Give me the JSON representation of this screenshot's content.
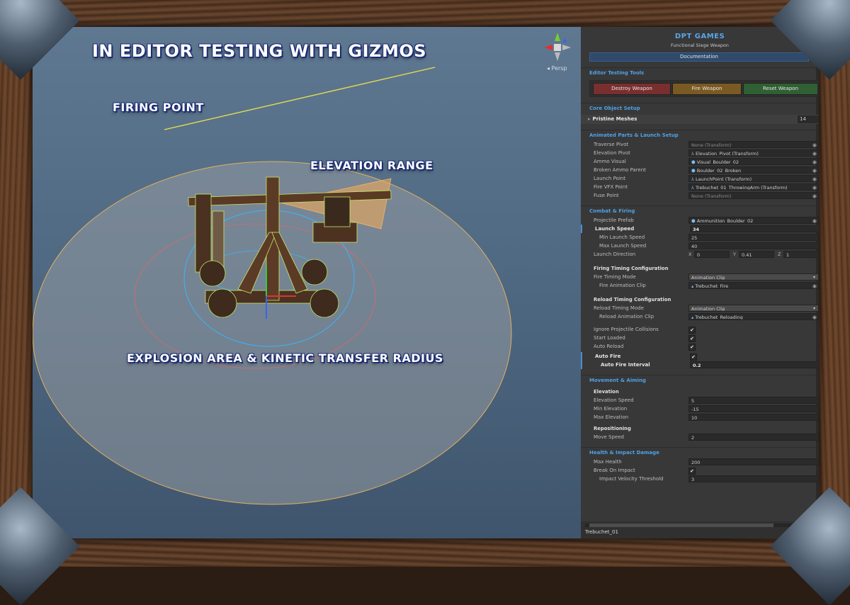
{
  "viewport": {
    "title": "IN EDITOR TESTING WITH GIZMOS",
    "labels": {
      "firing_point": "FIRING POINT",
      "elevation_range": "ELEVATION RANGE",
      "explosion": "EXPLOSION AREA & KINETIC TRANSFER RADIUS"
    },
    "persp_label": "◂ Persp",
    "colors": {
      "gizmo_line": "#e8e04a",
      "radius_outer": "#e0b060",
      "radius_inner": "#d86a6a",
      "wire": "#39b5ff"
    }
  },
  "inspector": {
    "title": "DPT GAMES",
    "subtitle": "Functional Siege Weapon",
    "documentation": "Documentation",
    "editor_tools": {
      "heading": "Editor Testing Tools",
      "buttons": [
        {
          "label": "Destroy Weapon",
          "color": "#7a2f2f"
        },
        {
          "label": "Fire Weapon",
          "color": "#7a5a22"
        },
        {
          "label": "Reset Weapon",
          "color": "#2f5f32"
        }
      ]
    },
    "core": {
      "heading": "Core Object Setup",
      "pristine_label": "Pristine Meshes",
      "pristine_count": "14"
    },
    "animated": {
      "heading": "Animated Parts & Launch Setup",
      "rows": [
        {
          "label": "Traverse Pivot",
          "value": "None (Transform)",
          "icon": "",
          "empty": true
        },
        {
          "label": "Elevation Pivot",
          "value": "Elevation_Pivot (Transform)",
          "icon": "⅄",
          "empty": false
        },
        {
          "label": "Ammo Visual",
          "value": "Visual_Boulder_02",
          "icon": "⬢",
          "empty": false
        },
        {
          "label": "Broken Ammo Parent",
          "value": "Boulder_02_Broken",
          "icon": "⬢",
          "empty": false
        },
        {
          "label": "Launch Point",
          "value": "LaunchPoint (Transform)",
          "icon": "⅄",
          "empty": false
        },
        {
          "label": "Fire VFX Point",
          "value": "Trebuchet_01_ThrowingArm (Transform)",
          "icon": "⅄",
          "empty": false
        },
        {
          "label": "Fuse Point",
          "value": "None (Transform)",
          "icon": "",
          "empty": true
        }
      ]
    },
    "combat": {
      "heading": "Combat & Firing",
      "projectile_label": "Projectile Prefab",
      "projectile_value": "Ammunition_Boulder_02",
      "launch_speed_label": "Launch Speed",
      "launch_speed_value": "34",
      "min_launch_label": "Min Launch Speed",
      "min_launch_value": "25",
      "max_launch_label": "Max Launch Speed",
      "max_launch_value": "40",
      "launch_dir_label": "Launch Direction",
      "launch_dir": {
        "x_label": "X",
        "x": "0",
        "y_label": "Y",
        "y": "0.41",
        "z_label": "Z",
        "z": "1"
      },
      "firing_timing_group": "Firing Timing Configuration",
      "fire_mode_label": "Fire Timing Mode",
      "fire_mode_value": "Animation Clip",
      "fire_clip_label": "Fire Animation Clip",
      "fire_clip_value": "Trebuchet_Fire",
      "reload_group": "Reload Timing Configuration",
      "reload_mode_label": "Reload Timing Mode",
      "reload_mode_value": "Animation Clip",
      "reload_clip_label": "Reload Animation Clip",
      "reload_clip_value": "Trebuchet_Reloading",
      "ignore_label": "Ignore Projectile Collisions",
      "start_loaded_label": "Start Loaded",
      "auto_reload_label": "Auto Reload",
      "auto_fire_label": "Auto Fire",
      "auto_fire_interval_label": "Auto Fire Interval",
      "auto_fire_interval_value": "0.2",
      "check": "✔"
    },
    "movement": {
      "heading": "Movement & Aiming",
      "elevation_group": "Elevation",
      "elev_speed_label": "Elevation Speed",
      "elev_speed_value": "5",
      "min_elev_label": "Min Elevation",
      "min_elev_value": "-15",
      "max_elev_label": "Max Elevation",
      "max_elev_value": "10",
      "repositioning_group": "Repositioning",
      "move_speed_label": "Move Speed",
      "move_speed_value": "2"
    },
    "health": {
      "heading": "Health & Impact Damage",
      "max_health_label": "Max Health",
      "max_health_value": "200",
      "break_label": "Break On Impact",
      "impact_label": "Impact Velocity Threshold",
      "impact_value": "3"
    },
    "object_name": "Trebuchet_01"
  }
}
